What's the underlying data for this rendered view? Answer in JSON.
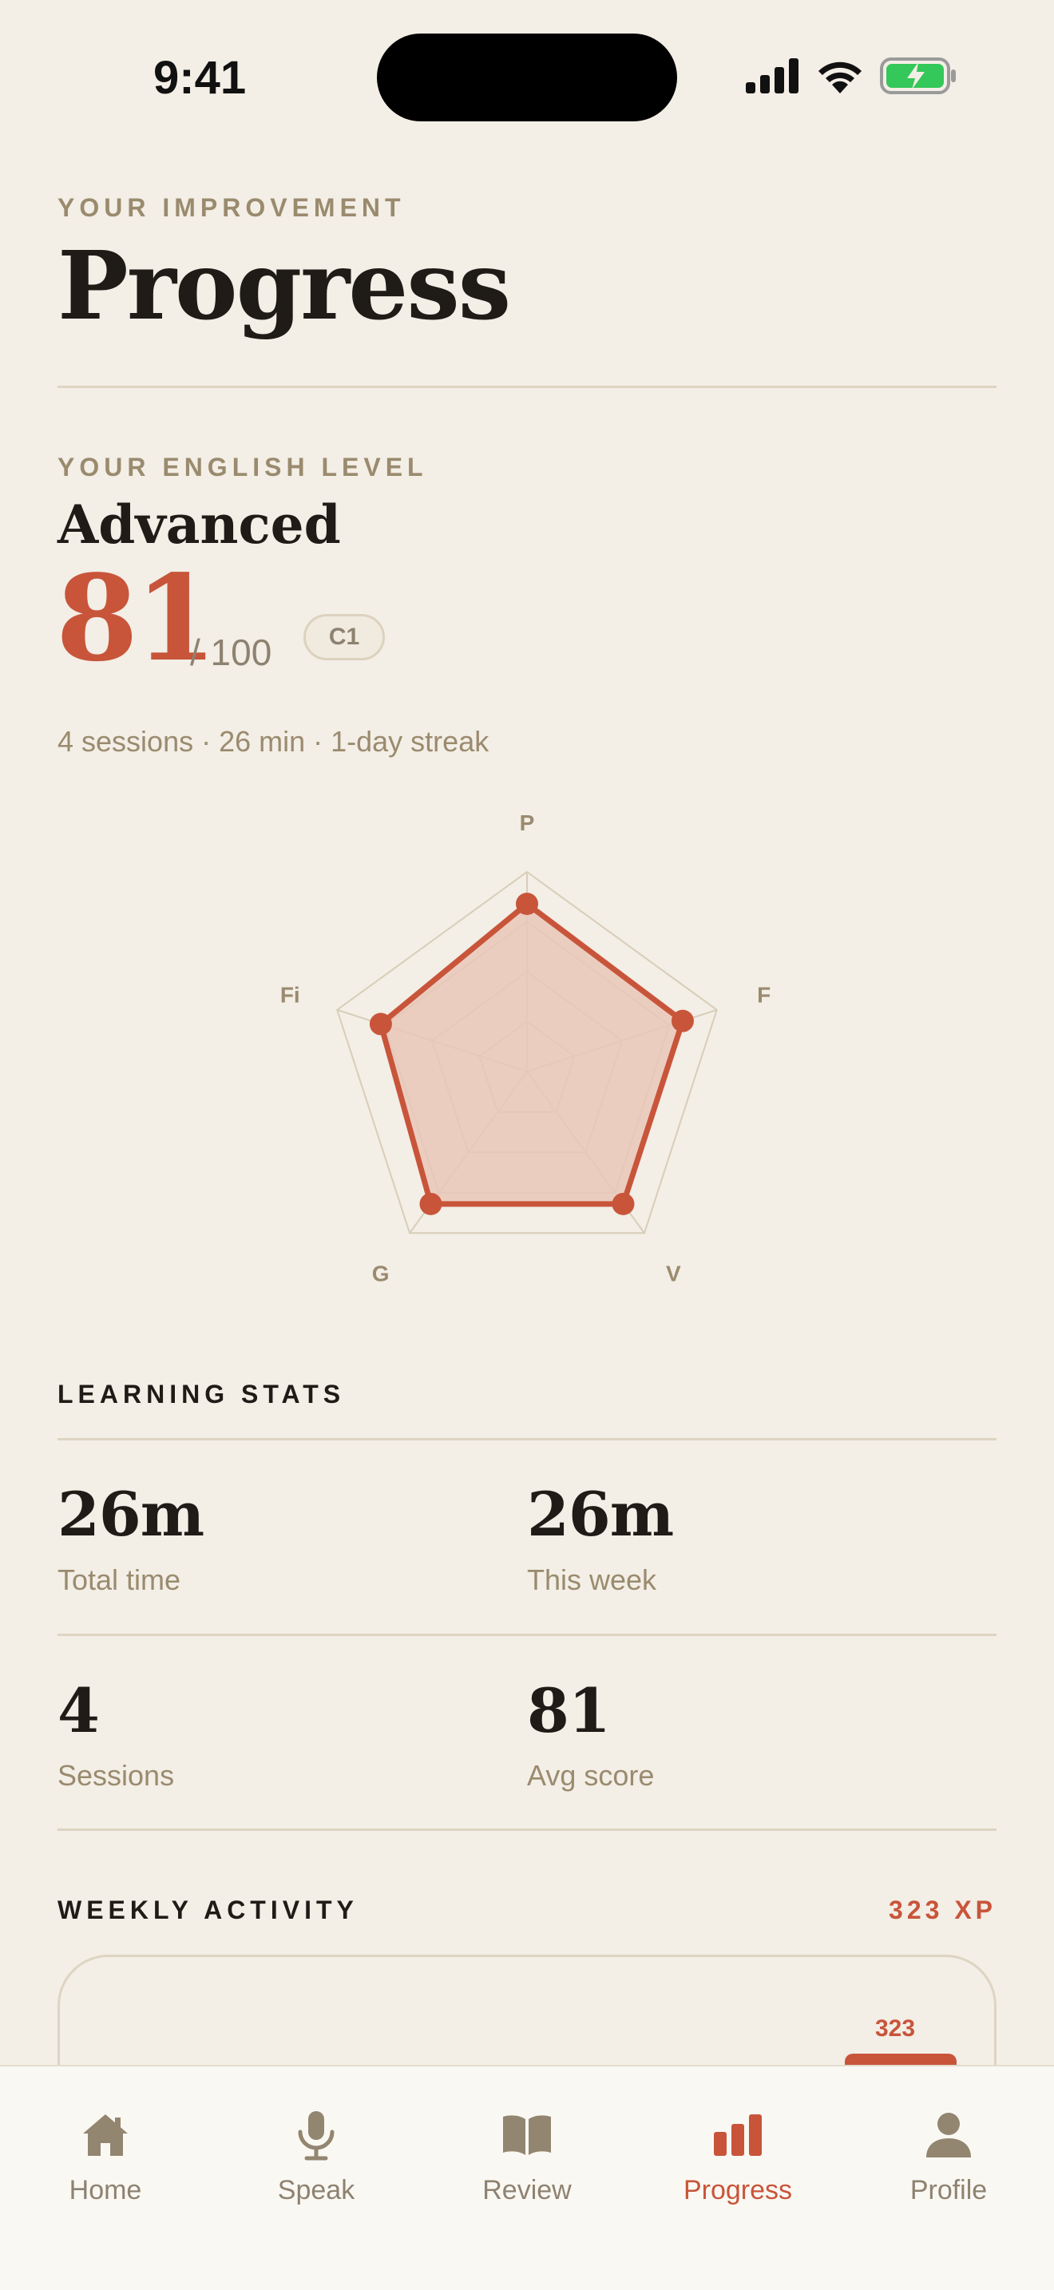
{
  "status_bar": {
    "time": "9:41"
  },
  "header": {
    "eyebrow": "YOUR IMPROVEMENT",
    "title": "Progress"
  },
  "level": {
    "eyebrow": "YOUR ENGLISH LEVEL",
    "name": "Advanced",
    "score": "81",
    "score_max": "/ 100",
    "badge": "C1",
    "summary": "4 sessions · 26 min · 1-day streak"
  },
  "chart_data": {
    "type": "radar",
    "axes": [
      "P",
      "F",
      "V",
      "G",
      "Fi"
    ],
    "values": [
      0.84,
      0.82,
      0.82,
      0.82,
      0.77
    ],
    "range": [
      0,
      1
    ],
    "rings": 4,
    "colors": {
      "series": "#C8553A",
      "fill": "#E9C7B8",
      "grid": "#D8CDB8"
    }
  },
  "learning_stats": {
    "heading": "LEARNING STATS",
    "items": [
      {
        "value": "26m",
        "label": "Total time"
      },
      {
        "value": "26m",
        "label": "This week"
      },
      {
        "value": "4",
        "label": "Sessions"
      },
      {
        "value": "81",
        "label": "Avg score"
      }
    ]
  },
  "weekly_activity": {
    "heading": "WEEKLY ACTIVITY",
    "total": "323 XP",
    "bar_value": "323"
  },
  "tab_bar": {
    "items": [
      {
        "label": "Home",
        "icon": "house-icon"
      },
      {
        "label": "Speak",
        "icon": "microphone-icon"
      },
      {
        "label": "Review",
        "icon": "book-icon"
      },
      {
        "label": "Progress",
        "icon": "bar-chart-icon",
        "active": true
      },
      {
        "label": "Profile",
        "icon": "person-icon"
      }
    ]
  },
  "colors": {
    "background": "#F3EEE6",
    "accent": "#C8553A",
    "muted": "#9A8B6E",
    "icon": "#938670"
  }
}
